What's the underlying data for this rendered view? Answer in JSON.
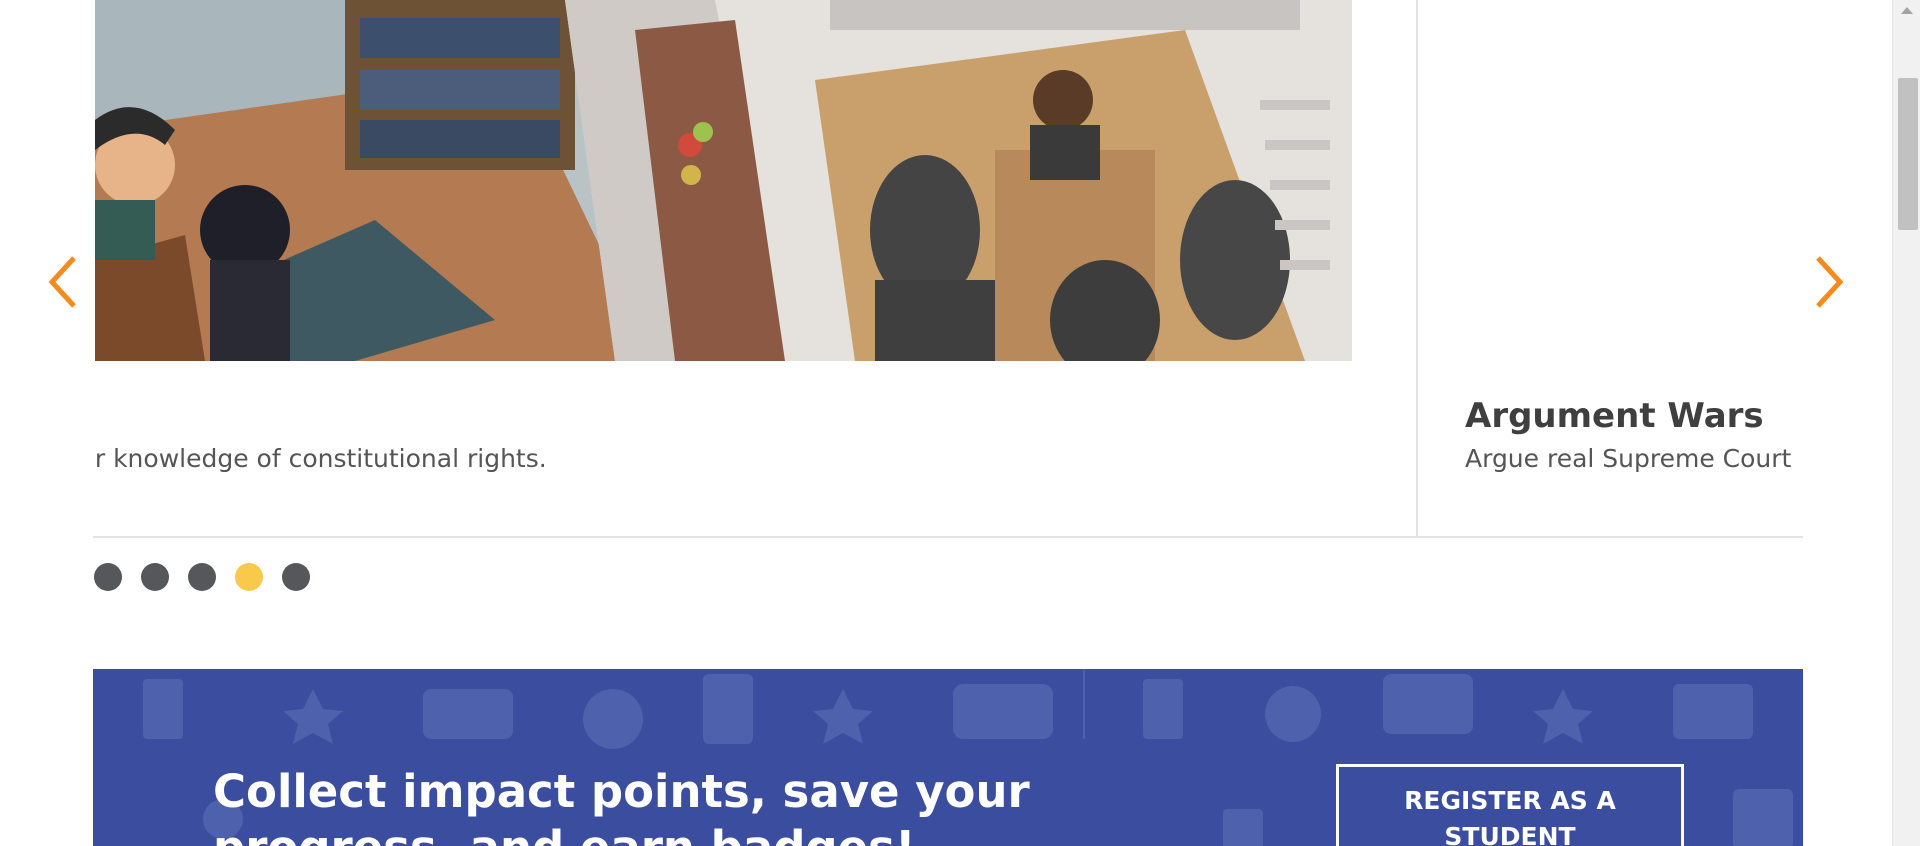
{
  "carousel": {
    "prev_arrow": "chevron-left-icon",
    "next_arrow": "chevron-right-icon",
    "cards": [
      {
        "title": "",
        "description": "ur knowledge of constitutional rights."
      },
      {
        "title": "Argument Wars",
        "description": "Argue real Supreme Court"
      }
    ],
    "dots": {
      "count": 5,
      "active_index": 3
    },
    "colors": {
      "arrow": "#f58a1f",
      "dot": "#56575b",
      "dot_active": "#f8c94a"
    }
  },
  "banner": {
    "text": "Collect impact points, save your progress, and earn badges!",
    "button_label": "REGISTER AS A STUDENT",
    "background": "#3a4d9f"
  }
}
